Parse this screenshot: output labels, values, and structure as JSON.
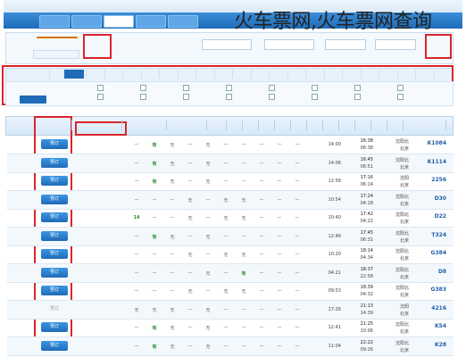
{
  "overlay_title": "火车票网,火车票网查询",
  "colors": {
    "nav_blue": "#1f6bb8",
    "accent_orange": "#f08a16",
    "annotation_red": "#d9252b",
    "available_green": "#2e8b2e"
  },
  "book_label": "预订",
  "trains": [
    {
      "no": "K1084",
      "from": "沈阳北",
      "to": "北京",
      "dep": "16:38",
      "arr": "06:38",
      "dur": "14:00",
      "seats": [
        "—",
        "—",
        "—",
        "—",
        "—",
        "无",
        "—",
        "无",
        "有",
        "—"
      ],
      "bookable": true
    },
    {
      "no": "K1114",
      "from": "沈阳北",
      "to": "北京",
      "dep": "16:45",
      "arr": "06:51",
      "dur": "14:06",
      "seats": [
        "—",
        "—",
        "—",
        "—",
        "—",
        "无",
        "—",
        "无",
        "有",
        "—"
      ],
      "bookable": true
    },
    {
      "no": "2256",
      "from": "沈阳",
      "to": "北京",
      "dep": "17:16",
      "arr": "06:14",
      "dur": "12:58",
      "seats": [
        "—",
        "—",
        "—",
        "—",
        "—",
        "无",
        "—",
        "无",
        "有",
        "—"
      ],
      "bookable": true
    },
    {
      "no": "D30",
      "from": "沈阳北",
      "to": "北京",
      "dep": "17:24",
      "arr": "04:18",
      "dur": "10:54",
      "seats": [
        "—",
        "—",
        "—",
        "无",
        "无",
        "—",
        "无",
        "—",
        "—",
        "—"
      ],
      "bookable": true
    },
    {
      "no": "D22",
      "from": "沈阳北",
      "to": "北京",
      "dep": "17:42",
      "arr": "04:22",
      "dur": "10:40",
      "seats": [
        "—",
        "—",
        "—",
        "无",
        "无",
        "—",
        "无",
        "—",
        "—",
        "14"
      ],
      "bookable": true
    },
    {
      "no": "T324",
      "from": "沈阳北",
      "to": "北京",
      "dep": "17:45",
      "arr": "06:31",
      "dur": "12:46",
      "seats": [
        "—",
        "—",
        "—",
        "—",
        "—",
        "无",
        "—",
        "无",
        "有",
        "—"
      ],
      "bookable": true
    },
    {
      "no": "G384",
      "from": "沈阳北",
      "to": "北京",
      "dep": "18:14",
      "arr": "04:34",
      "dur": "10:20",
      "seats": [
        "—",
        "—",
        "—",
        "无",
        "无",
        "—",
        "无",
        "—",
        "—",
        "—"
      ],
      "bookable": true
    },
    {
      "no": "D8",
      "from": "沈阳北",
      "to": "北京",
      "dep": "18:37",
      "arr": "22:58",
      "dur": "04:21",
      "seats": [
        "—",
        "—",
        "—",
        "有",
        "—",
        "无",
        "—",
        "—",
        "—",
        "—"
      ],
      "bookable": true
    },
    {
      "no": "G383",
      "from": "沈阳北",
      "to": "北京",
      "dep": "18:39",
      "arr": "04:32",
      "dur": "09:53",
      "seats": [
        "—",
        "—",
        "—",
        "无",
        "无",
        "—",
        "无",
        "—",
        "—",
        "—"
      ],
      "bookable": true
    },
    {
      "no": "4216",
      "from": "沈阳",
      "to": "北京",
      "dep": "21:13",
      "arr": "14:39",
      "dur": "17:26",
      "seats": [
        "—",
        "—",
        "—",
        "—",
        "—",
        "无",
        "—",
        "无",
        "无",
        "无"
      ],
      "bookable": false
    },
    {
      "no": "K54",
      "from": "沈阳北",
      "to": "北京",
      "dep": "21:25",
      "arr": "10:06",
      "dur": "12:41",
      "seats": [
        "—",
        "—",
        "—",
        "—",
        "—",
        "无",
        "—",
        "无",
        "有",
        "—"
      ],
      "bookable": true
    },
    {
      "no": "K28",
      "from": "沈阳北",
      "to": "北京",
      "dep": "22:22",
      "arr": "09:26",
      "dur": "11:04",
      "seats": [
        "—",
        "—",
        "—",
        "—",
        "—",
        "无",
        "—",
        "无",
        "有",
        "—"
      ],
      "bookable": true
    }
  ]
}
